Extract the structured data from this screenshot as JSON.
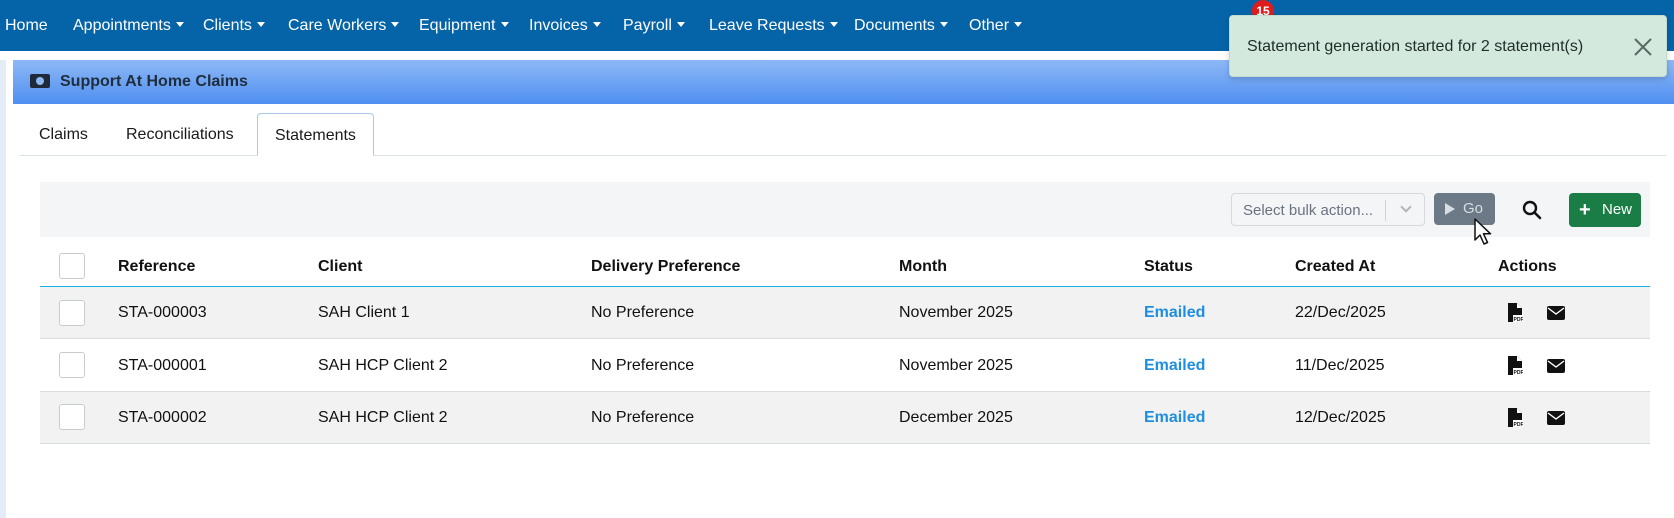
{
  "nav": {
    "items": [
      {
        "label": "Home",
        "dropdown": false
      },
      {
        "label": "Appointments",
        "dropdown": true
      },
      {
        "label": "Clients",
        "dropdown": true
      },
      {
        "label": "Care Workers",
        "dropdown": true
      },
      {
        "label": "Equipment",
        "dropdown": true
      },
      {
        "label": "Invoices",
        "dropdown": true
      },
      {
        "label": "Payroll",
        "dropdown": true
      },
      {
        "label": "Leave Requests",
        "dropdown": true
      },
      {
        "label": "Documents",
        "dropdown": true
      },
      {
        "label": "Other",
        "dropdown": true
      }
    ],
    "notification_count": "15"
  },
  "toast": {
    "message": "Statement generation started for 2 statement(s)",
    "close_icon": "close-icon"
  },
  "page": {
    "title": "Support At Home Claims",
    "title_icon": "money-icon"
  },
  "tabs": [
    {
      "label": "Claims",
      "active": false
    },
    {
      "label": "Reconciliations",
      "active": false
    },
    {
      "label": "Statements",
      "active": true
    }
  ],
  "toolbar": {
    "bulk_select_placeholder": "Select bulk action...",
    "go_label": "Go",
    "new_label": "New",
    "search_icon": "search-icon"
  },
  "table": {
    "columns": [
      "Reference",
      "Client",
      "Delivery Preference",
      "Month",
      "Status",
      "Created At",
      "Actions"
    ],
    "rows": [
      {
        "reference": "STA-000003",
        "client": "SAH Client 1",
        "delivery_preference": "No Preference",
        "month": "November 2025",
        "status": "Emailed",
        "created_at": "22/Dec/2025"
      },
      {
        "reference": "STA-000001",
        "client": "SAH HCP Client 2",
        "delivery_preference": "No Preference",
        "month": "November 2025",
        "status": "Emailed",
        "created_at": "11/Dec/2025"
      },
      {
        "reference": "STA-000002",
        "client": "SAH HCP Client 2",
        "delivery_preference": "No Preference",
        "month": "December 2025",
        "status": "Emailed",
        "created_at": "12/Dec/2025"
      }
    ],
    "action_icons": [
      "pdf-file-icon",
      "envelope-icon"
    ]
  },
  "colors": {
    "navbar": "#0563a8",
    "status_link": "#1e8fe0",
    "new_button": "#1a7d45",
    "toast_bg": "#d4e9dd",
    "header_gradient_top": "#8db8f6",
    "header_gradient_bottom": "#4f8ff0"
  }
}
